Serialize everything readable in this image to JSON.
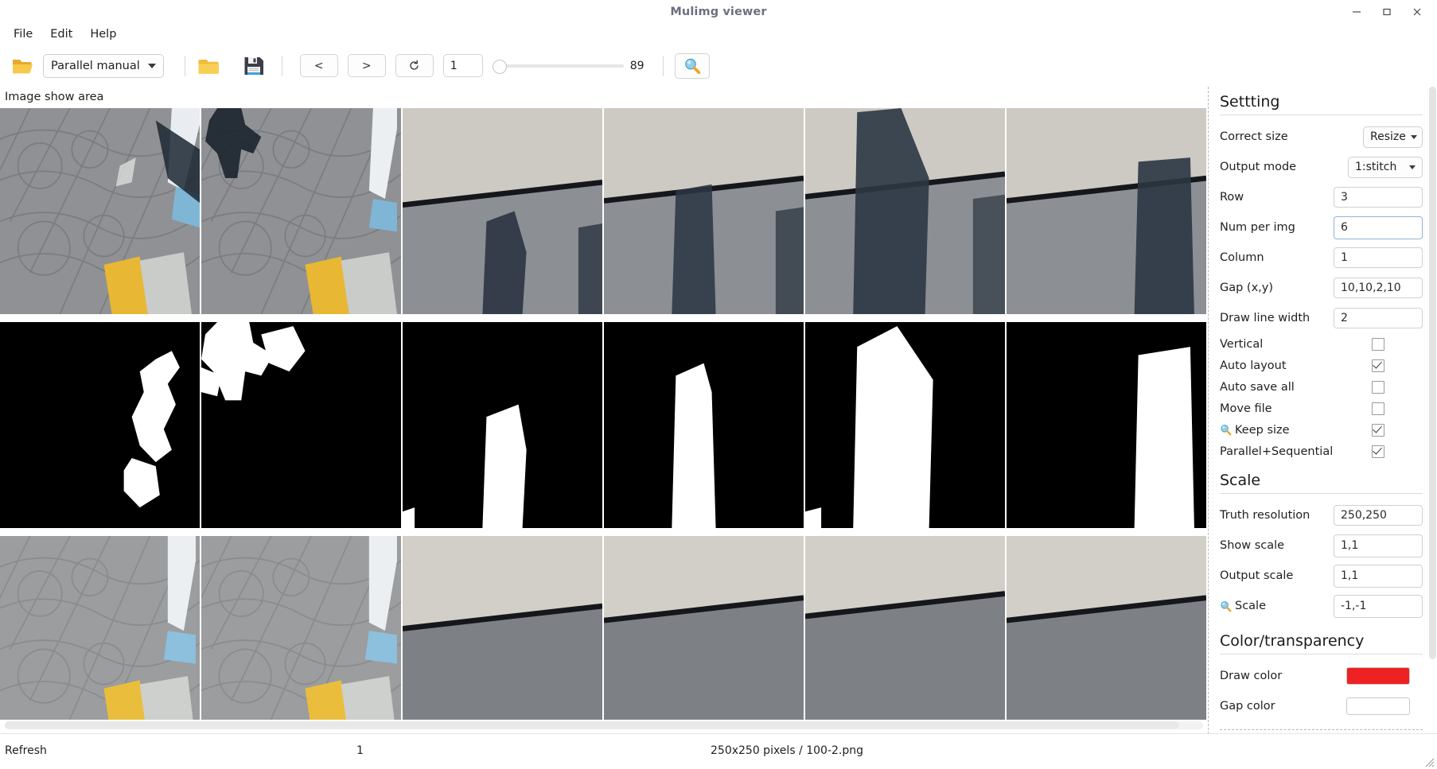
{
  "window": {
    "title": "Mulimg viewer",
    "controls": [
      {
        "name": "minimize",
        "glyph": "minimize-icon"
      },
      {
        "name": "maximize",
        "glyph": "maximize-icon"
      },
      {
        "name": "close",
        "glyph": "close-icon"
      }
    ]
  },
  "menubar": {
    "items": [
      {
        "label": "File"
      },
      {
        "label": "Edit"
      },
      {
        "label": "Help"
      }
    ]
  },
  "toolbar": {
    "open_folder_icon": "open-folder-icon",
    "mode_combo": {
      "value": "Parallel manual"
    },
    "output_folder_icon": "folder-icon",
    "save_icon": "save-floppy-icon",
    "prev_label": "<",
    "next_label": ">",
    "refresh_label": "↻",
    "index_value": "1",
    "slider_max_label": "89",
    "zoom_icon": "magnifier-icon"
  },
  "image_area": {
    "label": "Image show area",
    "rows": 3,
    "columns": 6
  },
  "settings": {
    "title": "Settting",
    "fields": [
      {
        "label": "Correct size",
        "type": "combo",
        "value": "Resize",
        "width": "resize"
      },
      {
        "label": "Output mode",
        "type": "combo",
        "value": "1:stitch",
        "width": "mode"
      },
      {
        "label": "Row",
        "type": "text",
        "value": "3"
      },
      {
        "label": "Num per img",
        "type": "text",
        "value": "6",
        "focused": true
      },
      {
        "label": "Column",
        "type": "text",
        "value": "1"
      },
      {
        "label": "Gap (x,y)",
        "type": "text",
        "value": "10,10,2,10"
      },
      {
        "label": "Draw line width",
        "type": "text",
        "value": "2"
      }
    ],
    "checkboxes": [
      {
        "label": "Vertical",
        "checked": false,
        "icon": null
      },
      {
        "label": "Auto layout",
        "checked": true,
        "icon": null
      },
      {
        "label": "Auto save all",
        "checked": false,
        "icon": null
      },
      {
        "label": "Move file",
        "checked": false,
        "icon": null
      },
      {
        "label": "Keep size",
        "checked": true,
        "icon": "magnifier-icon"
      },
      {
        "label": "Parallel+Sequential",
        "checked": true,
        "icon": null
      }
    ],
    "scale": {
      "title": "Scale",
      "fields": [
        {
          "label": "Truth resolution",
          "value": "250,250",
          "icon": null
        },
        {
          "label": "Show scale",
          "value": "1,1",
          "icon": null
        },
        {
          "label": "Output scale",
          "value": "1,1",
          "icon": null
        },
        {
          "label": "Scale",
          "value": "-1,-1",
          "icon": "magnifier-icon"
        }
      ]
    },
    "color": {
      "title": "Color/transparency",
      "fields": [
        {
          "label": "Draw  color",
          "value": "#ee2222"
        },
        {
          "label": "Gap color",
          "value": "#ffffff"
        }
      ]
    }
  },
  "statusbar": {
    "refresh": "Refresh",
    "index": "1",
    "info": "250x250 pixels / 100-2.png"
  },
  "colors": {
    "accent_red": "#ee2222",
    "title_text": "#6a7180",
    "folder_yellow": "#f5c33b",
    "magnifier_blue": "#6ec2e8"
  }
}
